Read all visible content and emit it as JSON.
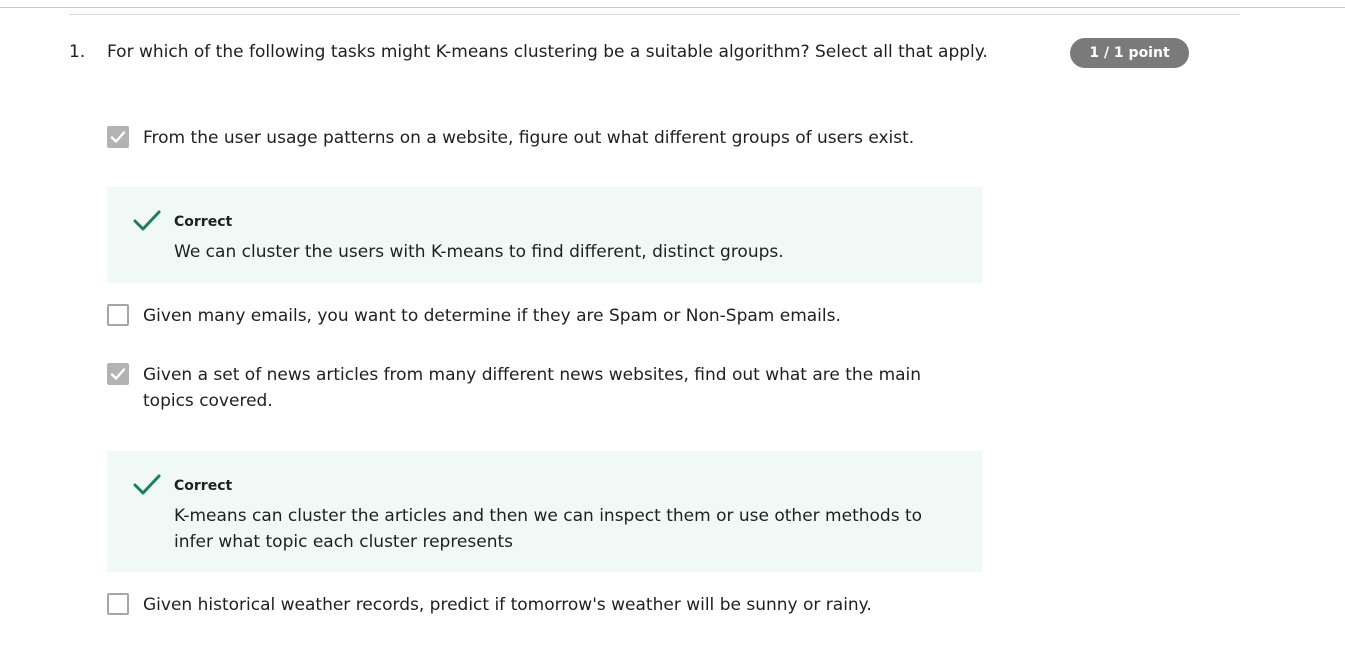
{
  "question": {
    "number": "1.",
    "text": "For which of the following tasks might K-means clustering be a suitable algorithm? Select all that apply.",
    "score": "1 / 1 point"
  },
  "options": [
    {
      "text": "From the user usage patterns on a website, figure out what different groups of users exist.",
      "checked": true,
      "feedback": {
        "label": "Correct",
        "text": "We can cluster the users with K-means to find different, distinct groups."
      }
    },
    {
      "text": "Given many emails, you want to determine if they are Spam or Non-Spam emails.",
      "checked": false
    },
    {
      "text": "Given a set of news articles from many different news websites, find out what are the main topics covered.",
      "checked": true,
      "feedback": {
        "label": "Correct",
        "text": "K-means can cluster the articles and then we can inspect them or use other methods to infer what topic each cluster represents"
      }
    },
    {
      "text": "Given historical weather records, predict if tomorrow's weather will be sunny or rainy.",
      "checked": false
    }
  ],
  "colors": {
    "feedback_background": "#f1f9f6",
    "correct_check": "#1a7f5a",
    "score_badge": "#7a7a7a",
    "checkbox_checked": "#b3b3b3"
  },
  "icons": {
    "correct": "check-mark-icon",
    "checkbox_checked": "checkbox-checked-icon",
    "checkbox_unchecked": "checkbox-unchecked-icon"
  }
}
